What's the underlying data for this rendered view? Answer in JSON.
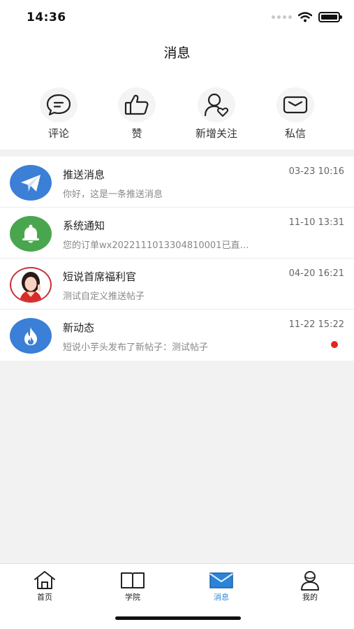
{
  "status_bar": {
    "time": "14:36"
  },
  "nav": {
    "title": "消息"
  },
  "quick_actions": [
    {
      "label": "评论",
      "icon": "comment-icon"
    },
    {
      "label": "赞",
      "icon": "thumbs-up-icon"
    },
    {
      "label": "新增关注",
      "icon": "new-follower-icon"
    },
    {
      "label": "私信",
      "icon": "envelope-icon"
    }
  ],
  "messages": [
    {
      "title": "推送消息",
      "time": "03-23 10:16",
      "preview": "你好，这是一条推送消息",
      "icon": "paper-plane-icon",
      "color": "#3b7fd6",
      "unread": false
    },
    {
      "title": "系统通知",
      "time": "11-10 13:31",
      "preview": "您的订单wx2022111013304810001已直…",
      "icon": "bell-icon",
      "color": "#4aa64e",
      "unread": false
    },
    {
      "title": "短说首席福利官",
      "time": "04-20 16:21",
      "preview": "测试自定义推送帖子",
      "icon": "user-photo-avatar",
      "color": "#c8313a",
      "unread": false
    },
    {
      "title": "新动态",
      "time": "11-22 15:22",
      "preview": "短说小芋头发布了新帖子：测试帖子",
      "icon": "flame-icon",
      "color": "#3b7fd6",
      "unread": true
    }
  ],
  "tab_bar": {
    "active": "消息",
    "tabs": [
      {
        "label": "首页",
        "icon": "home-icon"
      },
      {
        "label": "学院",
        "icon": "book-icon"
      },
      {
        "label": "消息",
        "icon": "envelope-icon"
      },
      {
        "label": "我的",
        "icon": "profile-icon"
      }
    ]
  },
  "colors": {
    "accent": "#2a84d8",
    "unread_dot": "#e0281e",
    "background": "#f2f2f2"
  }
}
